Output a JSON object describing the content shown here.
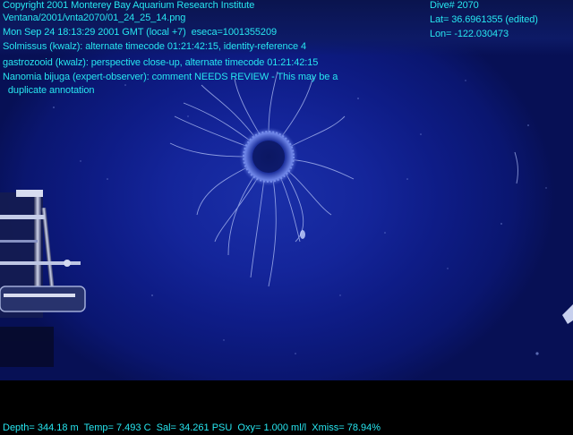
{
  "overlay": {
    "copyright": "Copyright 2001 Monterey Bay Aquarium Research Institute",
    "file_path": "Ventana/2001/vnta2070/01_24_25_14.png",
    "timestamp": "Mon Sep 24 18:13:29 2001 GMT (local +7)  eseca=1001355209",
    "annotations": [
      "Solmissus (kwalz): alternate timecode 01:21:42:15, identity-reference 4",
      "gastrozooid (kwalz): perspective close-up, alternate timecode 01:21:42:15",
      "Nanomia bijuga (expert-observer): comment NEEDS REVIEW - This may be a",
      "  duplicate annotation"
    ],
    "dive": "Dive# 2070",
    "lat": "Lat= 36.6961355 (edited)",
    "lon": "Lon= -122.030473"
  },
  "sensors": {
    "line": "Depth= 344.18 m  Temp= 7.493 C  Sal= 34.261 PSU  Oxy= 1.000 ml/l  Xmiss= 78.94%"
  },
  "colors": {
    "overlay_text": "#27e6f0",
    "water": "#14259a",
    "letterbox": "#000000"
  }
}
